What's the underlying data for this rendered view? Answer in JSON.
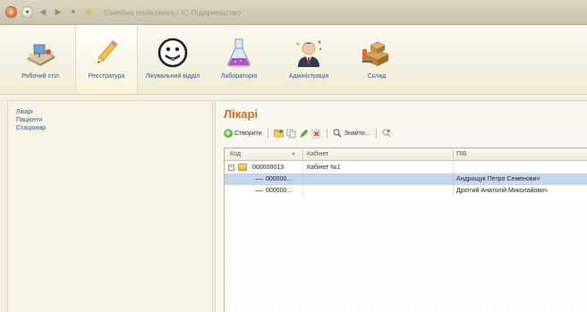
{
  "window": {
    "title": "Сімейна поліклініка / ІС Підприємство"
  },
  "sections": [
    {
      "label": "Робочий стіл",
      "icon": "desktop-icon",
      "active": false
    },
    {
      "label": "Реєстратура",
      "icon": "pencil-icon",
      "active": true
    },
    {
      "label": "Лікувальний відділ",
      "icon": "face-icon",
      "active": false
    },
    {
      "label": "Лабораторія",
      "icon": "flask-icon",
      "active": false
    },
    {
      "label": "Адміністрація",
      "icon": "manager-icon",
      "active": false
    },
    {
      "label": "Склад",
      "icon": "warehouse-icon",
      "active": false
    }
  ],
  "nav": {
    "items": [
      "Лікарі",
      "Пацієнти",
      "Стаціонар"
    ]
  },
  "form": {
    "title": "Лікарі",
    "toolbar": {
      "create_label": "Створити",
      "find_label": "Знайти..."
    },
    "columns": [
      "Код",
      "Кабінет",
      "ПІБ"
    ],
    "rows": [
      {
        "code": "000000013",
        "cabinet": "Кабінет №1",
        "name": "",
        "type": "group",
        "selected": false
      },
      {
        "code": "000000...",
        "cabinet": "",
        "name": "Андрощук Петро Семенович",
        "type": "item",
        "selected": true
      },
      {
        "code": "000000...",
        "cabinet": "",
        "name": "Дроггий Анатолій Миколайович",
        "type": "item",
        "selected": false
      }
    ]
  },
  "colors": {
    "accent_title": "#d36b17",
    "link": "#2f5c84",
    "selection": "#c6d6ee",
    "panel_bg": "#f4f1e4"
  }
}
